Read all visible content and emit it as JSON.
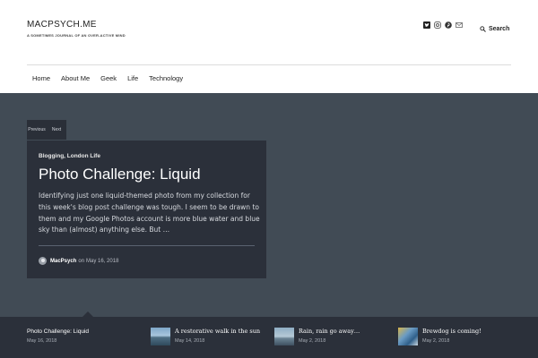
{
  "site": {
    "title": "MACPSYCH.ME",
    "tagline": "A SOMETIMES JOURNAL OF AN OVER-ACTIVE MIND"
  },
  "social": {
    "items": [
      {
        "icon": "twitter-icon",
        "label": ""
      },
      {
        "icon": "instagram-icon",
        "label": ""
      },
      {
        "icon": "pinterest-icon",
        "label": ""
      },
      {
        "icon": "email-icon",
        "label": ""
      }
    ]
  },
  "search": {
    "label": "Search"
  },
  "nav": {
    "items": [
      "Home",
      "About Me",
      "Geek",
      "Life",
      "Technology"
    ]
  },
  "slider": {
    "previous_label": "Previous",
    "next_label": "Next"
  },
  "featured": {
    "categories": "Blogging, London Life",
    "title": "Photo Challenge: Liquid",
    "excerpt": "Identifying just one liquid-themed photo from my collection for this week's blog post challenge was tough. I seem to be drawn to them and my Google Photos account is more blue water and blue sky than (almost) anything else. But …",
    "author": "MacPsych",
    "date_prefix": "on",
    "date": "May 16, 2018"
  },
  "strip": {
    "items": [
      {
        "title": "Photo Challenge: Liquid",
        "date": "May 16, 2018",
        "has_thumb": false
      },
      {
        "title": "A restorative walk in the sun",
        "date": "May 14, 2018",
        "has_thumb": true
      },
      {
        "title": "Rain, rain go away…",
        "date": "May 2, 2018",
        "has_thumb": true
      },
      {
        "title": "Brewdog is coming!",
        "date": "May 2, 2018",
        "has_thumb": true
      }
    ]
  },
  "colors": {
    "hero_bg": "#414b55",
    "card_bg": "#2b303a",
    "strip_bg": "#2b303a"
  }
}
